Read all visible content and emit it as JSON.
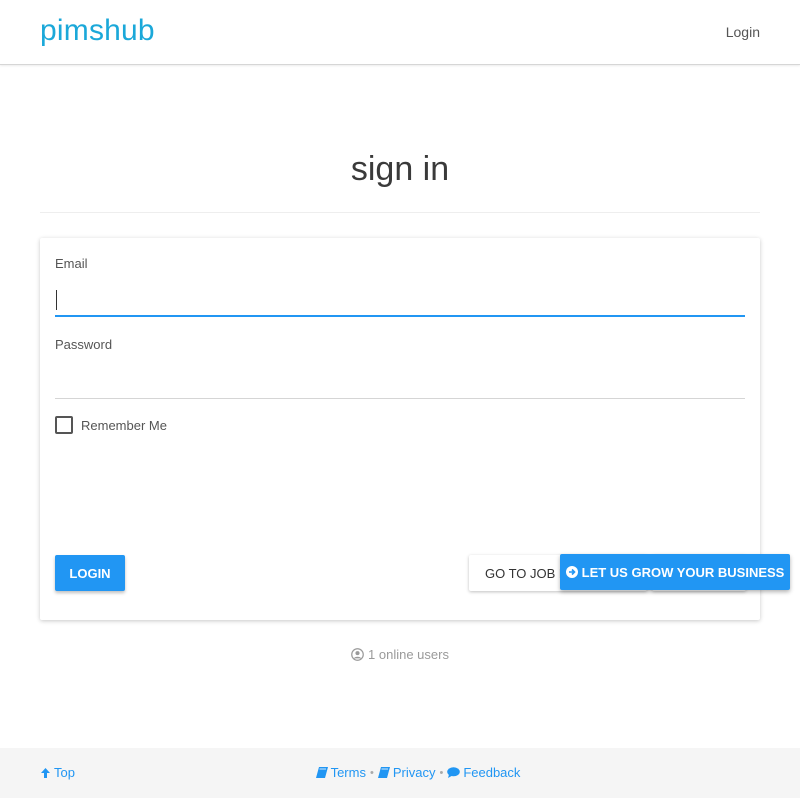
{
  "header": {
    "brand": "pimshub",
    "login_link": "Login"
  },
  "page": {
    "title": "sign in"
  },
  "form": {
    "email_label": "Email",
    "email_value": "",
    "password_label": "Password",
    "password_value": "",
    "remember_label": "Remember Me",
    "remember_checked": false,
    "login_button": "LOGIN",
    "job_button": "GO TO JOB F",
    "grow_button": "LET US GROW YOUR BUSINESS"
  },
  "status": {
    "online_users": "1 online users"
  },
  "footer": {
    "top_link": "Top",
    "terms": "Terms",
    "sep1": "•",
    "privacy": "Privacy",
    "sep2": "•",
    "feedback": "Feedback"
  },
  "colors": {
    "brand": "#1ba8d9",
    "primary": "#2196f3",
    "footer_bg": "#f5f5f5",
    "muted": "#9a9a9a"
  },
  "icons": {
    "grow": "arrow-circle-right-icon",
    "online": "user-circle-icon",
    "top": "arrow-up-icon",
    "terms": "book-icon",
    "privacy": "book-icon",
    "feedback": "comment-icon"
  }
}
